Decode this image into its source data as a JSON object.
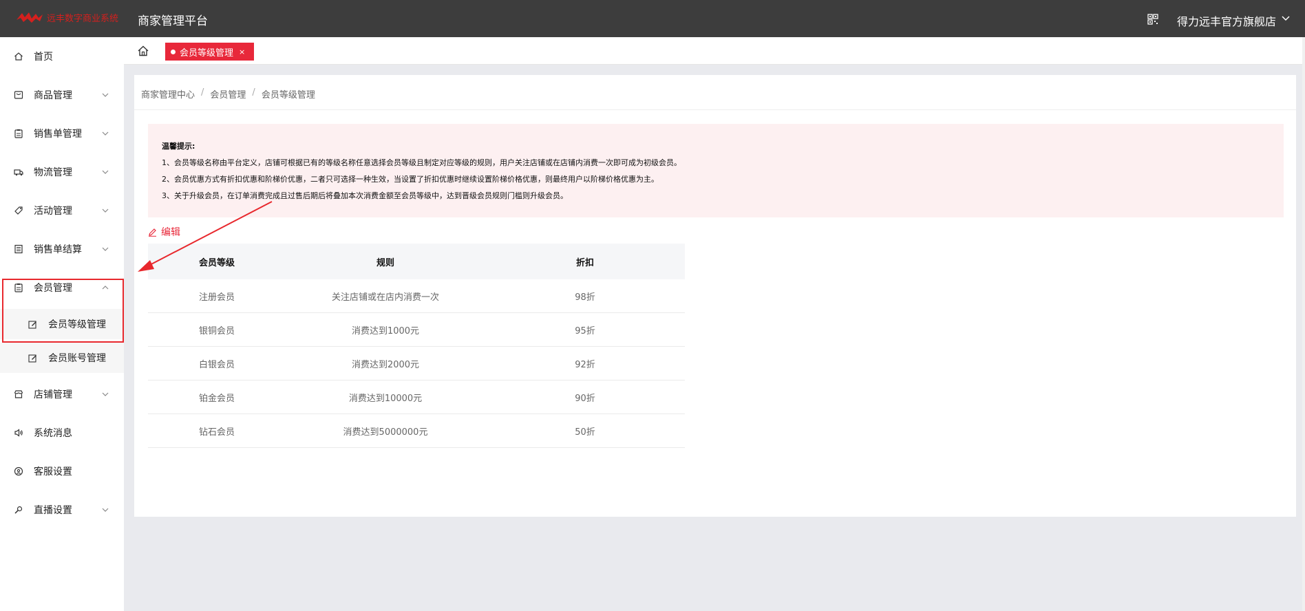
{
  "header": {
    "logo_text": "远丰数字商业系统",
    "platform_title": "商家管理平台",
    "shop_name": "得力远丰官方旗舰店"
  },
  "sidebar": {
    "items": [
      {
        "label": "首页",
        "icon": "home-icon"
      },
      {
        "label": "商品管理",
        "icon": "box-icon"
      },
      {
        "label": "销售单管理",
        "icon": "clipboard-icon"
      },
      {
        "label": "物流管理",
        "icon": "truck-icon"
      },
      {
        "label": "活动管理",
        "icon": "tag-icon"
      },
      {
        "label": "销售单结算",
        "icon": "ledger-icon"
      },
      {
        "label": "会员管理",
        "icon": "member-icon"
      },
      {
        "label": "店铺管理",
        "icon": "store-icon"
      },
      {
        "label": "系统消息",
        "icon": "speaker-icon"
      },
      {
        "label": "客服设置",
        "icon": "service-icon"
      },
      {
        "label": "直播设置",
        "icon": "mic-icon"
      }
    ],
    "sub_items": [
      {
        "label": "会员等级管理",
        "icon": "edit-icon"
      },
      {
        "label": "会员账号管理",
        "icon": "edit-icon"
      }
    ]
  },
  "tabs": {
    "active_label": "会员等级管理",
    "close": "×"
  },
  "breadcrumb": [
    "商家管理中心",
    "会员管理",
    "会员等级管理"
  ],
  "breadcrumb_sep": "/",
  "notice": {
    "title": "温馨提示:",
    "lines": [
      "1、会员等级名称由平台定义，店铺可根据已有的等级名称任意选择会员等级且制定对应等级的规则，用户关注店铺或在店铺内消费一次即可成为初级会员。",
      "2、会员优惠方式有折扣优惠和阶梯价优惠，二者只可选择一种生效，当设置了折扣优惠时继续设置阶梯价格优惠，则最终用户以阶梯价格优惠为主。",
      "3、关于升级会员，在订单消费完成且过售后期后将叠加本次消费金额至会员等级中，达到晋级会员规则门槛则升级会员。"
    ]
  },
  "edit_label": "编辑",
  "table": {
    "headers": [
      "会员等级",
      "规则",
      "折扣"
    ],
    "rows": [
      [
        "注册会员",
        "关注店铺或在店内消费一次",
        "98折"
      ],
      [
        "银铜会员",
        "消费达到1000元",
        "95折"
      ],
      [
        "白银会员",
        "消费达到2000元",
        "92折"
      ],
      [
        "铂金会员",
        "消费达到10000元",
        "90折"
      ],
      [
        "钻石会员",
        "消费达到5000000元",
        "50折"
      ]
    ]
  },
  "colors": {
    "topbar": "#3d3d3d",
    "accent": "#e8283a",
    "notice_bg": "#fdf0f1"
  }
}
